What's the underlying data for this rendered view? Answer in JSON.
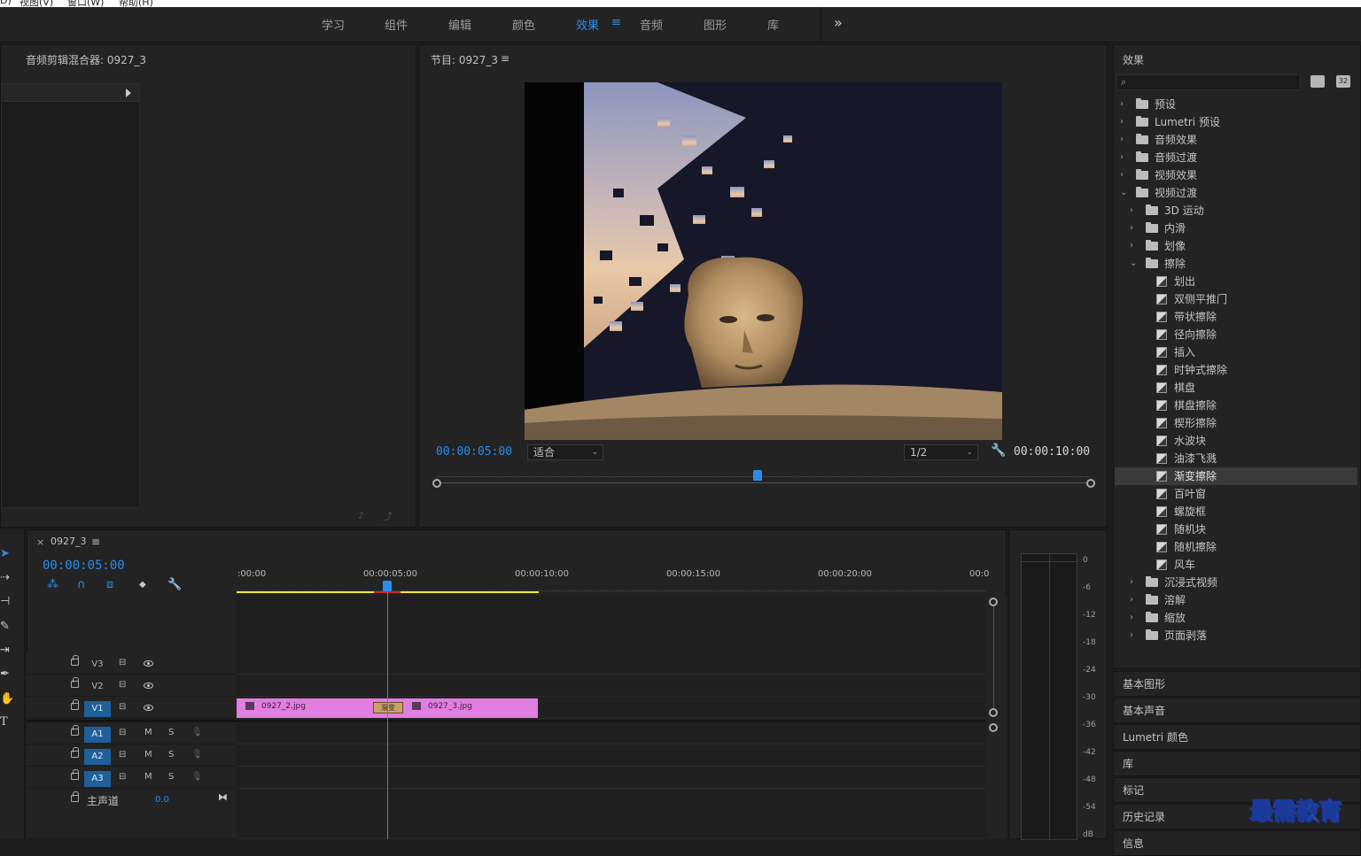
{
  "menubar": {
    "items": [
      "D)",
      "视图(V)",
      "窗口(W)",
      "帮助(H)"
    ]
  },
  "workspaces": {
    "tabs": [
      "学习",
      "组件",
      "编辑",
      "颜色",
      "效果",
      "音频",
      "图形",
      "库"
    ],
    "active": "效果",
    "menu_glyph": "≡",
    "overflow": "»"
  },
  "audio_mixer": {
    "title": "音频剪辑混合器: 0927_3"
  },
  "program_monitor": {
    "title": "节目: 0927_3",
    "menu_glyph": "≡",
    "current_time": "00:00:05:00",
    "duration": "00:00:10:00",
    "fit_value": "适合",
    "resolution_value": "1/2",
    "playhead_fraction": 0.49
  },
  "effects_panel": {
    "title": "效果",
    "search_placeholder": "",
    "buttons": [
      "32"
    ],
    "items": [
      {
        "label": "预设",
        "level": 0,
        "kind": "preset",
        "open": false
      },
      {
        "label": "Lumetri 预设",
        "level": 0,
        "kind": "preset",
        "open": false
      },
      {
        "label": "音频效果",
        "level": 0,
        "kind": "folder",
        "open": false
      },
      {
        "label": "音频过渡",
        "level": 0,
        "kind": "folder",
        "open": false
      },
      {
        "label": "视频效果",
        "level": 0,
        "kind": "folder",
        "open": false
      },
      {
        "label": "视频过渡",
        "level": 0,
        "kind": "folder",
        "open": true
      },
      {
        "label": "3D 运动",
        "level": 1,
        "kind": "folder",
        "open": false
      },
      {
        "label": "内滑",
        "level": 1,
        "kind": "folder",
        "open": false
      },
      {
        "label": "划像",
        "level": 1,
        "kind": "folder",
        "open": false
      },
      {
        "label": "擦除",
        "level": 1,
        "kind": "folder",
        "open": true
      },
      {
        "label": "划出",
        "level": 2,
        "kind": "fx"
      },
      {
        "label": "双侧平推门",
        "level": 2,
        "kind": "fx"
      },
      {
        "label": "带状擦除",
        "level": 2,
        "kind": "fx"
      },
      {
        "label": "径向擦除",
        "level": 2,
        "kind": "fx"
      },
      {
        "label": "插入",
        "level": 2,
        "kind": "fx"
      },
      {
        "label": "时钟式擦除",
        "level": 2,
        "kind": "fx"
      },
      {
        "label": "棋盘",
        "level": 2,
        "kind": "fx"
      },
      {
        "label": "棋盘擦除",
        "level": 2,
        "kind": "fx"
      },
      {
        "label": "楔形擦除",
        "level": 2,
        "kind": "fx"
      },
      {
        "label": "水波块",
        "level": 2,
        "kind": "fx"
      },
      {
        "label": "油漆飞溅",
        "level": 2,
        "kind": "fx"
      },
      {
        "label": "渐变擦除",
        "level": 2,
        "kind": "fx",
        "selected": true
      },
      {
        "label": "百叶窗",
        "level": 2,
        "kind": "fx"
      },
      {
        "label": "螺旋框",
        "level": 2,
        "kind": "fx"
      },
      {
        "label": "随机块",
        "level": 2,
        "kind": "fx"
      },
      {
        "label": "随机擦除",
        "level": 2,
        "kind": "fx"
      },
      {
        "label": "风车",
        "level": 2,
        "kind": "fx"
      },
      {
        "label": "沉浸式视频",
        "level": 1,
        "kind": "folder",
        "open": false
      },
      {
        "label": "溶解",
        "level": 1,
        "kind": "folder",
        "open": false
      },
      {
        "label": "缩放",
        "level": 1,
        "kind": "folder",
        "open": false
      },
      {
        "label": "页面剥落",
        "level": 1,
        "kind": "folder",
        "open": false
      }
    ]
  },
  "collapsed_panels": [
    "基本图形",
    "基本声音",
    "Lumetri 颜色",
    "库",
    "标记",
    "历史记录",
    "信息"
  ],
  "timeline": {
    "tab_title": "0927_3",
    "close_glyph": "×",
    "menu_glyph": "≡",
    "current_time": "00:00:05:00",
    "ruler_labels": [
      ":00:00",
      "00:00:05:00",
      "00:00:10:00",
      "00:00:15:00",
      "00:00:20:00",
      "00:0"
    ],
    "video_tracks": [
      {
        "name": "V3",
        "targeted": false
      },
      {
        "name": "V2",
        "targeted": false
      },
      {
        "name": "V1",
        "targeted": true
      }
    ],
    "audio_tracks": [
      {
        "name": "A1",
        "m": "M",
        "s": "S"
      },
      {
        "name": "A2",
        "m": "M",
        "s": "S"
      },
      {
        "name": "A3",
        "m": "M",
        "s": "S"
      }
    ],
    "master": {
      "label": "主声道",
      "value": "0.0"
    },
    "clips": [
      {
        "name": "0927_2.jpg"
      },
      {
        "name": "0927_3.jpg"
      }
    ],
    "transition_label": "渐变"
  },
  "audio_meter": {
    "ticks": [
      "0",
      "-6",
      "-12",
      "-18",
      "-24",
      "-30",
      "-36",
      "-42",
      "-48",
      "-54",
      "dB"
    ]
  },
  "watermark": "最需教育",
  "colors": {
    "accent": "#2d8ceb",
    "clip": "#e07fe0",
    "work_area": "#e8e83a",
    "panel_bg": "#232323"
  }
}
